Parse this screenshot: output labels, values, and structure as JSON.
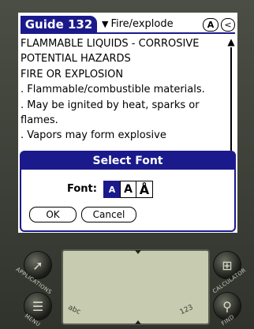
{
  "header": {
    "guide_tab": "Guide 132",
    "category": "Fire/explode",
    "btn_a": "A",
    "btn_back": "<"
  },
  "body_lines": [
    "FLAMMABLE LIQUIDS - CORROSIVE",
    "POTENTIAL HAZARDS",
    "FIRE OR EXPLOSION",
    ". Flammable/combustible materials.",
    ". May be ignited by heat, sparks or",
    "flames.",
    ". Vapors may form explosive"
  ],
  "dialog": {
    "title": "Select Font",
    "font_label": "Font:",
    "font_options": [
      "A",
      "A",
      "Å"
    ],
    "selected_index": 0,
    "ok_label": "OK",
    "cancel_label": "Cancel"
  },
  "silkscreen": {
    "applications": "APPLICATIONS",
    "menu": "MENU",
    "calculator": "CALCULATOR",
    "find": "FIND",
    "graffiti_left": "abc",
    "graffiti_right": "123"
  },
  "colors": {
    "accent": "#1b1a8c",
    "screen_bg": "#ffffff",
    "graffiti_bg": "#c7cbb0"
  }
}
